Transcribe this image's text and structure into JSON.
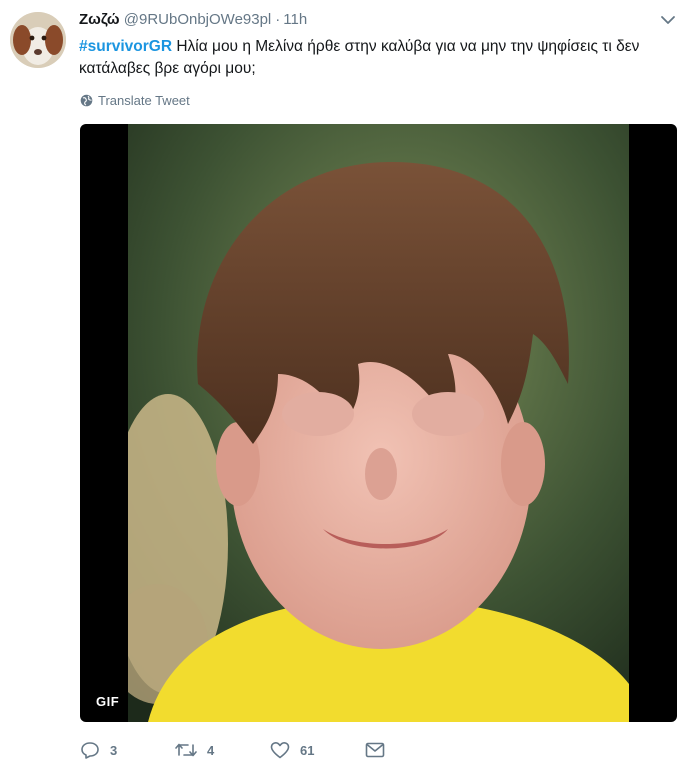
{
  "tweet": {
    "author": {
      "name": "Ζωζώ",
      "handle": "@9RUbOnbjOWe93pl"
    },
    "separator": "·",
    "time": "11h",
    "hashtag": "#survivorGR",
    "body": " Ηλία μου η Μελίνα ήρθε στην καλύβα για να μην την ψηφίσεις τι δεν κατάλαβες βρε αγόρι μου;",
    "translate_label": "Translate Tweet",
    "media": {
      "badge": "GIF"
    },
    "actions": {
      "replies": "3",
      "retweets": "4",
      "likes": "61"
    }
  },
  "colors": {
    "hashtag": "#1b95e0",
    "muted": "#657786",
    "text": "#14171a",
    "media_bg": "#000000",
    "shirt": "#f2dc2e"
  }
}
